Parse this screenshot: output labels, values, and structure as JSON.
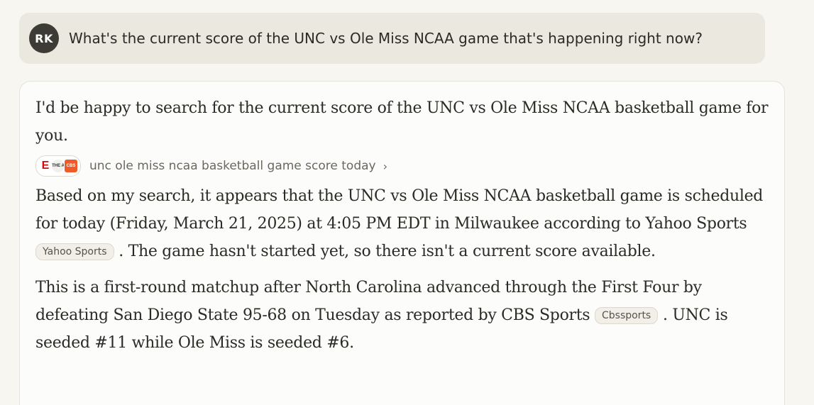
{
  "user_message": {
    "avatar_initials": "RK",
    "text": "What's the current score of the UNC vs Ole Miss NCAA game that's happening right now?"
  },
  "assistant": {
    "intro": "I'd be happy to search for the current score of the UNC vs Ole Miss NCAA basketball game for you.",
    "search": {
      "query": "unc ole miss ncaa basketball game score today",
      "chevron": "›",
      "source_icons": [
        "espn-icon",
        "the-athletic-icon",
        "cbs-sports-icon"
      ],
      "icon_labels": {
        "espn": "E",
        "athletic": "THE A",
        "cbs": "CBS"
      }
    },
    "para1_before": "Based on my search, it appears that the UNC vs Ole Miss NCAA basketball game is scheduled for today (Friday, March 21, 2025) at 4:05 PM EDT in Milwaukee according to Yahoo Sports",
    "citation1": "Yahoo Sports",
    "para1_after": ". The game hasn't started yet, so there isn't a current score available.",
    "para2_before": "This is a first-round matchup after North Carolina advanced through the First Four by defeating San Diego State 95-68 on Tuesday as reported by CBS Sports",
    "citation2": "Cbssports",
    "para2_after": ". UNC is seeded #11 while Ole Miss is seeded #6."
  },
  "colors": {
    "background": "#f7f6f1",
    "user_bubble": "#ebe8df",
    "avatar": "#3d3b35",
    "card": "#fcfcfa",
    "text": "#2b2a26",
    "muted_text": "#6b6860"
  }
}
